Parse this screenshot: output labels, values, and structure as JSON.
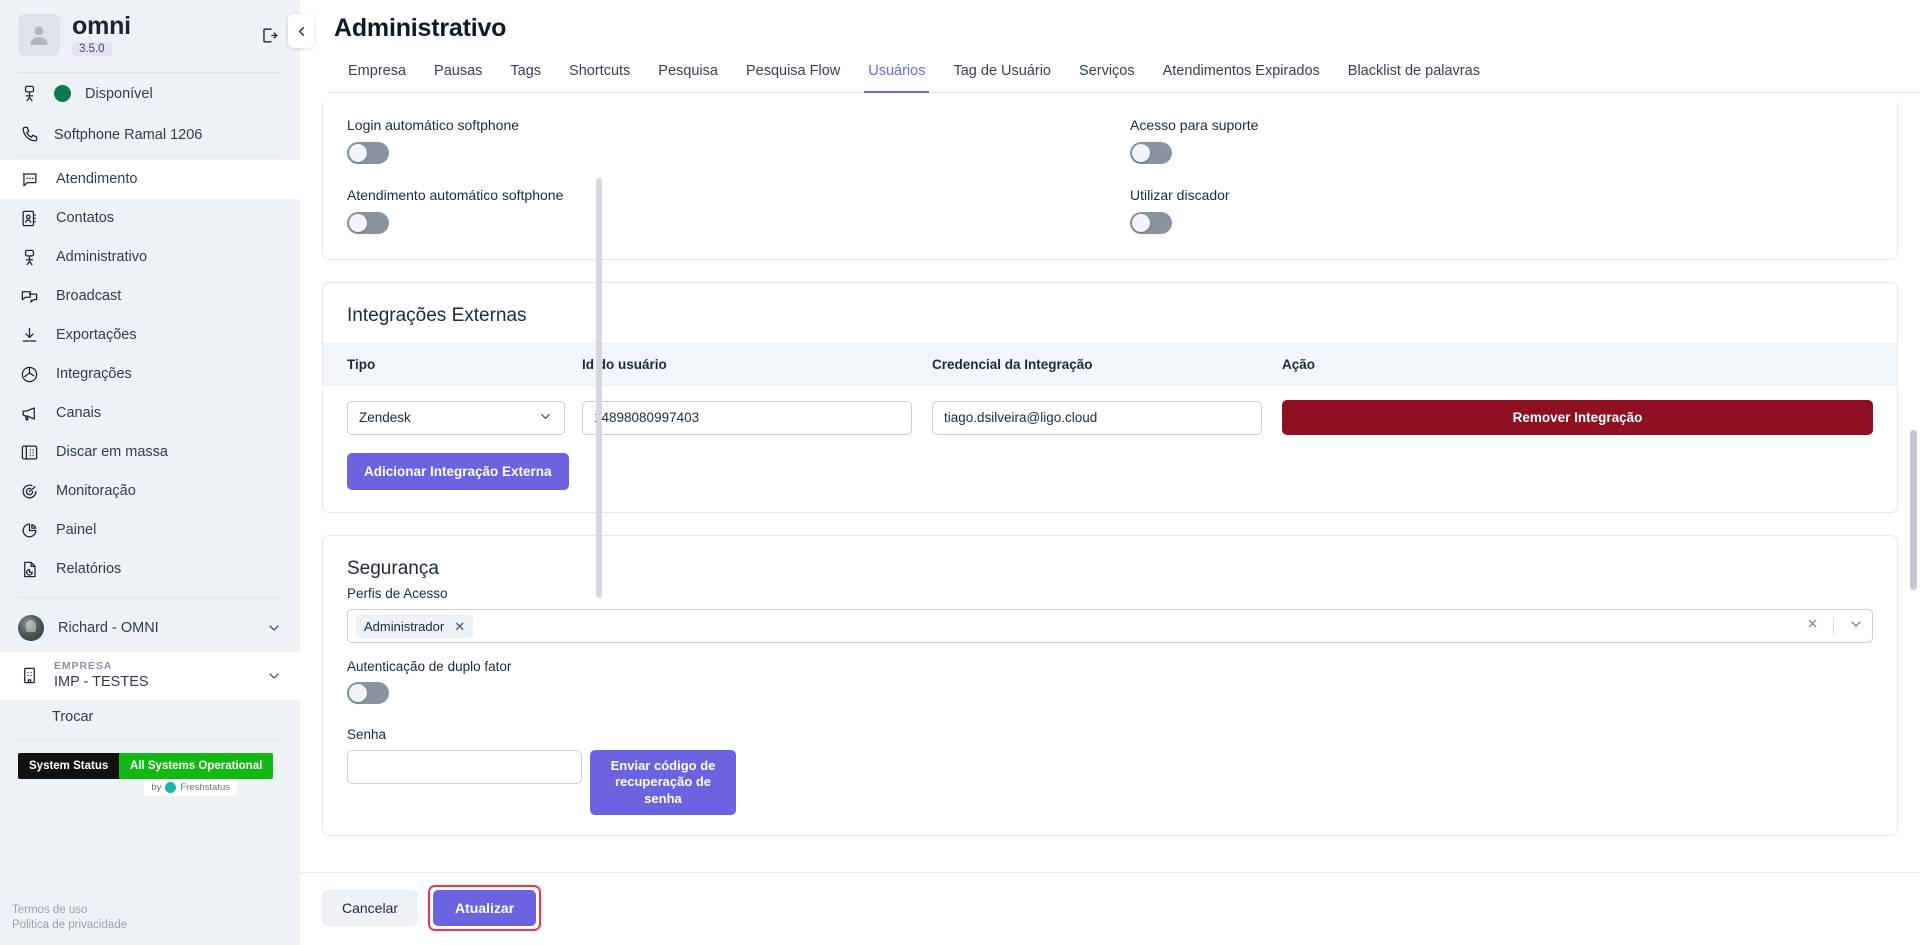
{
  "sidebar": {
    "brand_name": "omni",
    "version": "3.5.0",
    "logout_icon": "logout-icon",
    "status": {
      "label": "Disponível",
      "icon": "desk-icon",
      "color": "#0d7a4e"
    },
    "softphone": {
      "label": "Softphone Ramal 1206",
      "icon": "phone-icon"
    },
    "nav_items": [
      {
        "label": "Atendimento",
        "icon": "chat-icon",
        "active": true
      },
      {
        "label": "Contatos",
        "icon": "contacts-icon",
        "active": false
      },
      {
        "label": "Administrativo",
        "icon": "desk-icon",
        "active": false
      },
      {
        "label": "Broadcast",
        "icon": "broadcast-icon",
        "active": false
      },
      {
        "label": "Exportações",
        "icon": "download-icon",
        "active": false
      },
      {
        "label": "Integrações",
        "icon": "integrations-icon",
        "active": false
      },
      {
        "label": "Canais",
        "icon": "megaphone-icon",
        "active": false
      },
      {
        "label": "Discar em massa",
        "icon": "deskphone-icon",
        "active": false
      },
      {
        "label": "Monitoração",
        "icon": "target-icon",
        "active": false
      },
      {
        "label": "Painel",
        "icon": "pie-chart-icon",
        "active": false
      },
      {
        "label": "Relatórios",
        "icon": "report-icon",
        "active": false
      }
    ],
    "user": {
      "name": "Richard - OMNI",
      "chevron": "chevron-down-icon"
    },
    "company": {
      "label": "EMPRESA",
      "name": "IMP - TESTES",
      "icon": "building-icon",
      "chevron": "chevron-down-icon"
    },
    "switch_label": "Trocar",
    "status_widget": {
      "left": "System Status",
      "right": "All Systems Operational",
      "by": "by",
      "provider": "Freshstatus"
    },
    "legal": [
      "Termos de uso",
      "Politica de privacidade"
    ]
  },
  "header": {
    "collapse_icon": "chevron-left-icon",
    "title": "Administrativo",
    "tabs": [
      {
        "label": "Empresa",
        "active": false
      },
      {
        "label": "Pausas",
        "active": false
      },
      {
        "label": "Tags",
        "active": false
      },
      {
        "label": "Shortcuts",
        "active": false
      },
      {
        "label": "Pesquisa",
        "active": false
      },
      {
        "label": "Pesquisa Flow",
        "active": false
      },
      {
        "label": "Usuários",
        "active": true
      },
      {
        "label": "Tag de Usuário",
        "active": false
      },
      {
        "label": "Serviços",
        "active": false
      },
      {
        "label": "Atendimentos Expirados",
        "active": false
      },
      {
        "label": "Blacklist de palavras",
        "active": false
      }
    ]
  },
  "settings": {
    "toggles": [
      {
        "label": "Login automático softphone",
        "on": false
      },
      {
        "label": "Acesso para suporte",
        "on": false
      },
      {
        "label": "Atendimento automático softphone",
        "on": false
      },
      {
        "label": "Utilizar discador",
        "on": false
      }
    ]
  },
  "integrations": {
    "title": "Integrações Externas",
    "columns": [
      "Tipo",
      "Id do usuário",
      "Credencial da Integração",
      "Ação"
    ],
    "rows": [
      {
        "tipo": "Zendesk",
        "id_usuario": "14898080997403",
        "credencial": "tiago.dsilveira@ligo.cloud",
        "action_label": "Remover Integração"
      }
    ],
    "add_button": "Adicionar Integração Externa"
  },
  "security": {
    "title": "Segurança",
    "profiles_label": "Perfis de Acesso",
    "profiles_selected": [
      "Administrador"
    ],
    "clear_icon": "clear-icon",
    "chevron_icon": "chevron-down-icon",
    "two_factor_label": "Autenticação de duplo fator",
    "two_factor_on": false,
    "password_label": "Senha",
    "password_value": "",
    "send_code_button": "Enviar código de recuperação de senha"
  },
  "footer": {
    "cancel_label": "Cancelar",
    "update_label": "Atualizar",
    "update_highlight_color": "#f5334a"
  },
  "theme": {
    "accent": "#6c63e0",
    "danger": "#8f1020",
    "sidebar_bg": "#eef1f6",
    "tab_active": "#6366f1",
    "status_green": "#14b814"
  }
}
